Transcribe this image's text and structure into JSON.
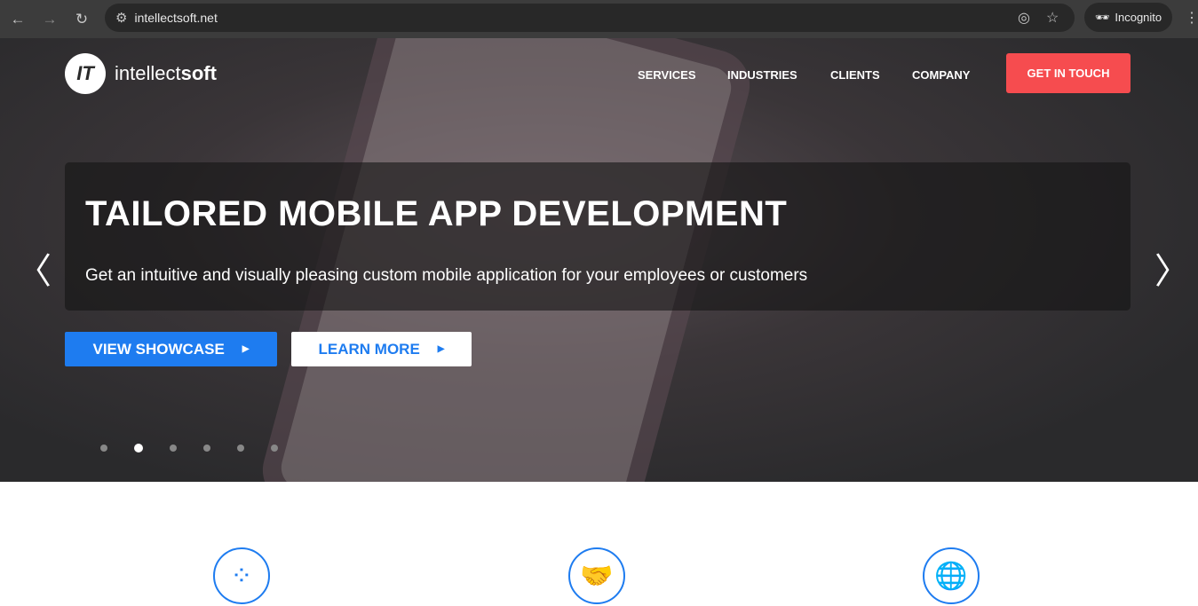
{
  "browser": {
    "url": "intellectsoft.net",
    "profile": "Incognito"
  },
  "site": {
    "logo_mark": "IT",
    "logo_light": "intellect",
    "logo_bold": "soft",
    "nav": [
      "SERVICES",
      "INDUSTRIES",
      "CLIENTS",
      "COMPANY"
    ],
    "cta": "GET IN TOUCH"
  },
  "hero": {
    "title": "TAILORED MOBILE APP DEVELOPMENT",
    "subtitle": "Get an intuitive and visually pleasing custom mobile application for your employees or customers",
    "primary": "VIEW SHOWCASE",
    "secondary": "LEARN MORE",
    "slide_count": 6,
    "active_slide": 2
  },
  "features": [
    {
      "icon": "people-circle-icon"
    },
    {
      "icon": "handshake-icon"
    },
    {
      "icon": "globe-icon"
    }
  ],
  "colors": {
    "accent": "#1e7cf0",
    "cta": "#f64c4f"
  }
}
